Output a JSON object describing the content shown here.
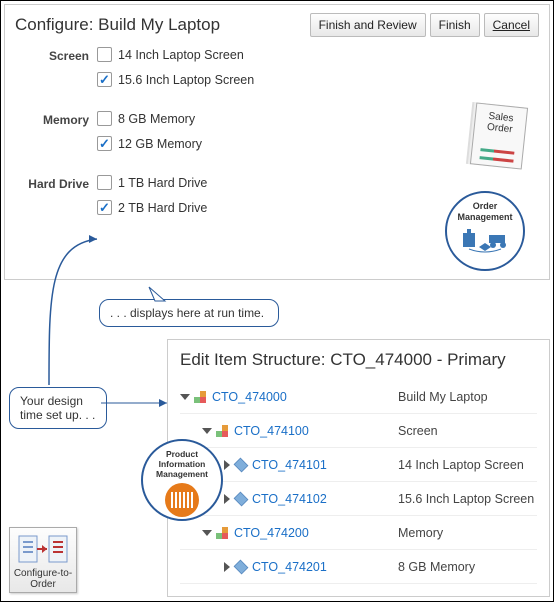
{
  "configure": {
    "title": "Configure: Build My Laptop",
    "buttons": {
      "finish_review": "Finish and Review",
      "finish": "Finish",
      "cancel": "Cancel"
    },
    "groups": [
      {
        "label": "Screen",
        "items": [
          {
            "label": "14 Inch Laptop Screen",
            "checked": false
          },
          {
            "label": "15.6 Inch Laptop Screen",
            "checked": true
          }
        ]
      },
      {
        "label": "Memory",
        "items": [
          {
            "label": "8 GB Memory",
            "checked": false
          },
          {
            "label": "12 GB Memory",
            "checked": true
          }
        ]
      },
      {
        "label": "Hard Drive",
        "items": [
          {
            "label": "1 TB Hard Drive",
            "checked": false
          },
          {
            "label": "2 TB Hard Drive",
            "checked": true
          }
        ]
      }
    ]
  },
  "sales_order_label": "Sales Order",
  "order_mgmt_label": "Order Management",
  "callouts": {
    "runtime": ". . . displays here at run time.",
    "design": "Your design time set up. . ."
  },
  "edit": {
    "title": "Edit Item Structure: CTO_474000 - Primary",
    "rows": [
      {
        "indent": 0,
        "disclosure": "open",
        "icon": "group",
        "code": "CTO_474000",
        "desc": "Build My Laptop"
      },
      {
        "indent": 1,
        "disclosure": "open",
        "icon": "group",
        "code": "CTO_474100",
        "desc": "Screen"
      },
      {
        "indent": 2,
        "disclosure": "closed",
        "icon": "cube",
        "code": "CTO_474101",
        "desc": "14 Inch Laptop Screen"
      },
      {
        "indent": 2,
        "disclosure": "closed",
        "icon": "cube",
        "code": "CTO_474102",
        "desc": "15.6 Inch Laptop Screen"
      },
      {
        "indent": 1,
        "disclosure": "open",
        "icon": "group",
        "code": "CTO_474200",
        "desc": "Memory"
      },
      {
        "indent": 2,
        "disclosure": "closed",
        "icon": "cube",
        "code": "CTO_474201",
        "desc": "8 GB Memory"
      }
    ]
  },
  "pim_label": "Product Information Management",
  "cto_label": "Configure-to-Order"
}
